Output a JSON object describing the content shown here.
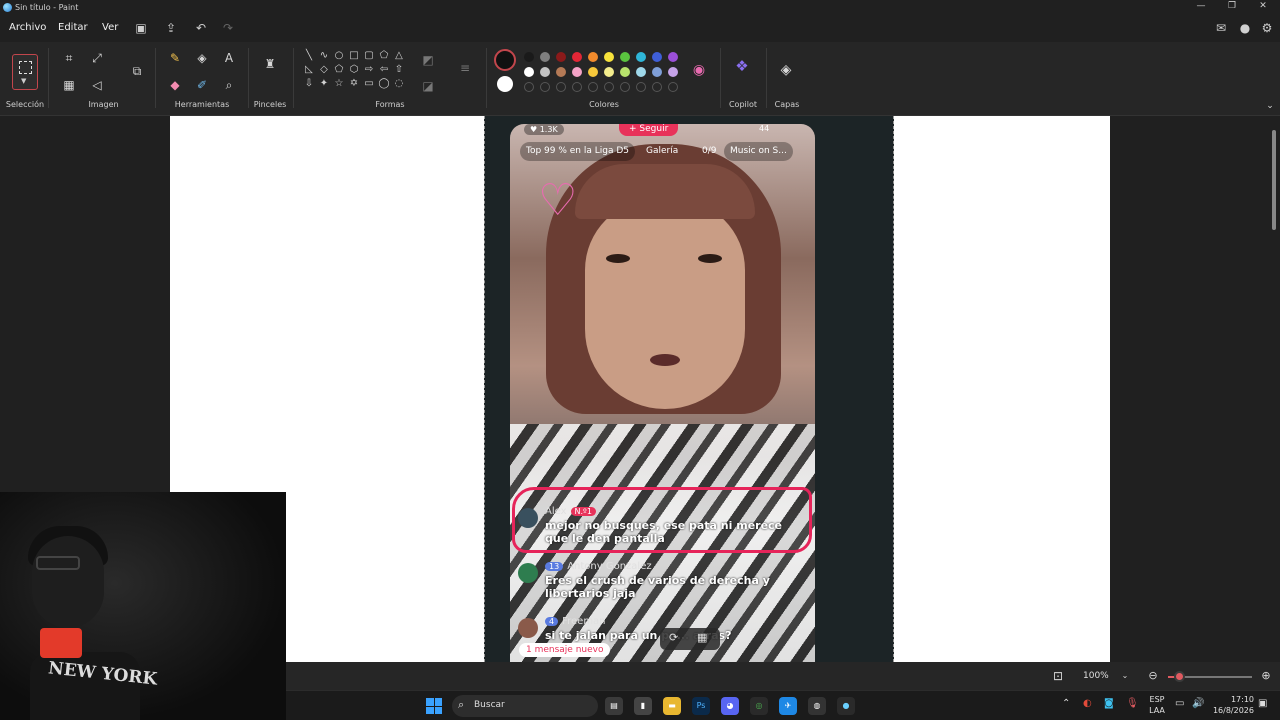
{
  "window": {
    "title": "Sin título - Paint"
  },
  "menu": {
    "file": "Archivo",
    "edit": "Editar",
    "view": "Ver"
  },
  "ribbon": {
    "groups": {
      "selection": "Selección",
      "image": "Imagen",
      "tools": "Herramientas",
      "brushes": "Pinceles",
      "shapes": "Formas",
      "colors": "Colores",
      "copilot": "Copilot",
      "layers": "Capas"
    },
    "palette_row1": [
      "#1a1a1a",
      "#7f7f7f",
      "#8b1a1a",
      "#e32636",
      "#f28b2c",
      "#f7e23b",
      "#5ac33f",
      "#2fb6d8",
      "#3f5fd8",
      "#9b4fd8"
    ],
    "palette_row2": [
      "#ffffff",
      "#c3c3c3",
      "#b57a56",
      "#f5a3c7",
      "#f7c83b",
      "#f3ec8c",
      "#b8e36c",
      "#9fd8ea",
      "#7f9fd8",
      "#c6a3e8"
    ]
  },
  "tiktok": {
    "likes": "1.3K",
    "follow": "+ Seguir",
    "top_right": "44",
    "chips": [
      "Top 99 % en la Liga D5",
      "Galería",
      "0/9",
      "Music on S..."
    ],
    "messages": [
      {
        "user": "Alex",
        "badge": "N.º1",
        "text": "mejor no busques, ese pata ni merece que le den pantalla"
      },
      {
        "user": "Antony Gonzalez",
        "badge": "13",
        "text": "Eres el crush de varios de derecha y libertarios jaja"
      },
      {
        "user": "Freeman",
        "badge": "4",
        "text": "si te jalan para un po... atras?"
      }
    ],
    "new_message": "1 mensaje nuevo"
  },
  "status": {
    "zoom": "100%",
    "zoom_fraction": 0.1
  },
  "taskbar": {
    "search": "Buscar",
    "language": "ESP",
    "language_sub": "LAA",
    "time": "17:10",
    "date": "16/8/2026"
  },
  "webcam": {
    "shirt_text": "NEW YORK"
  }
}
